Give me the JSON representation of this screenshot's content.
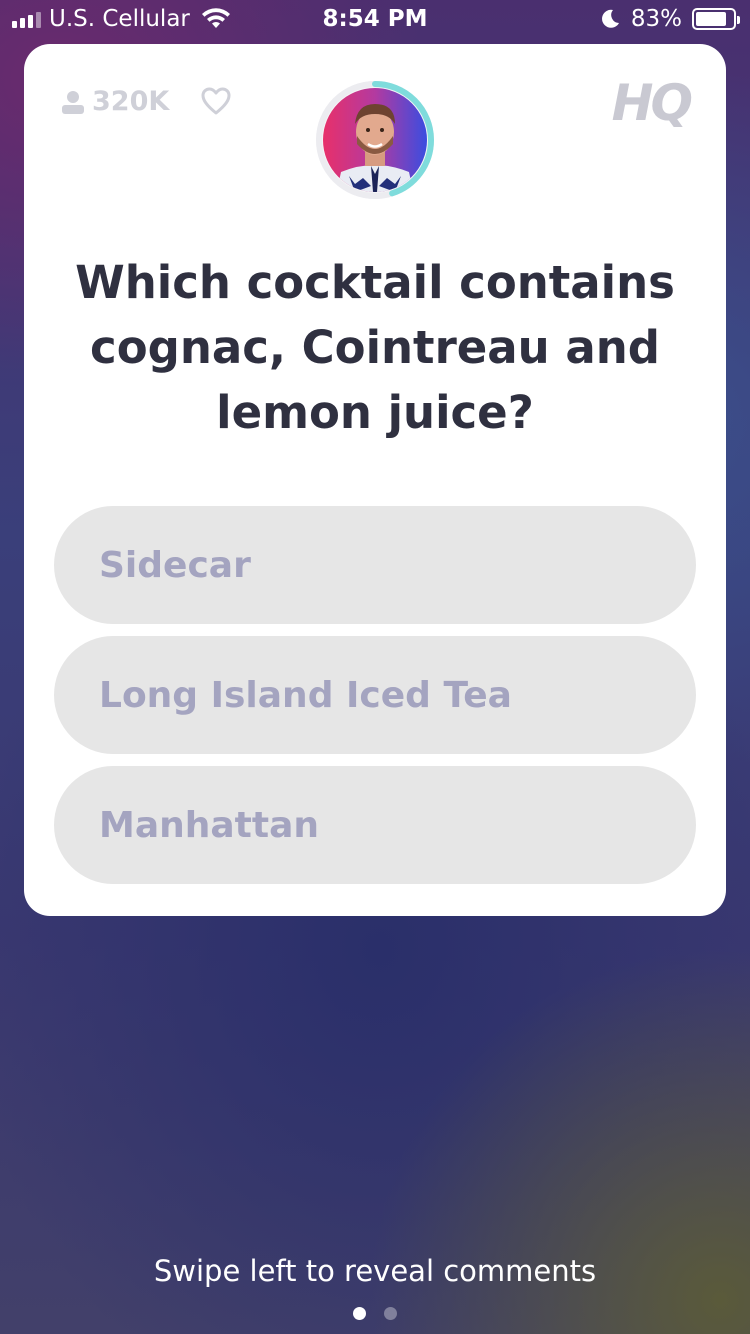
{
  "status_bar": {
    "carrier": "U.S. Cellular",
    "time": "8:54 PM",
    "battery_percent_label": "83%",
    "battery_level": 0.83
  },
  "card": {
    "viewer_count": "320K",
    "logo_text": "HQ",
    "question": "Which cocktail contains cognac, Cointreau and lemon juice?",
    "options": [
      {
        "label": "Sidecar"
      },
      {
        "label": "Long Island Iced Tea"
      },
      {
        "label": "Manhattan"
      }
    ],
    "timer_progress": 0.45
  },
  "footer": {
    "swipe_hint": "Swipe left to reveal comments",
    "pages": 2,
    "active_page": 0
  },
  "colors": {
    "card_bg": "#ffffff",
    "option_bg": "#e6e6e6",
    "option_text": "#a4a4c0",
    "question_text": "#2f3040",
    "timer_ring": "#7fdcdc"
  }
}
